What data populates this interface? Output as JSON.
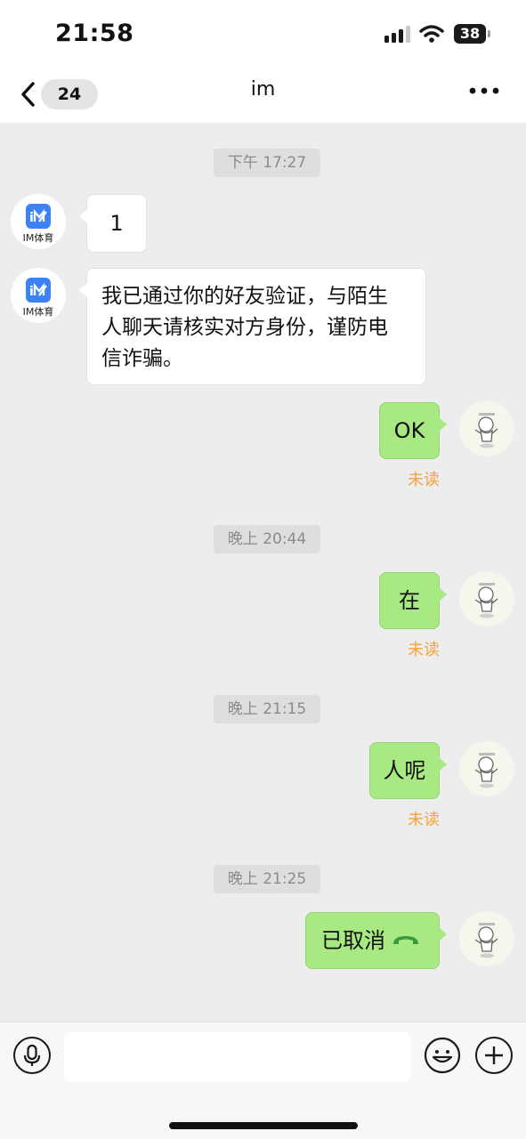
{
  "status_bar": {
    "time": "21:58",
    "battery": "38",
    "icons": [
      "signal-icon",
      "wifi-icon",
      "battery-icon"
    ]
  },
  "header": {
    "back_count": "24",
    "title": "im",
    "icons": [
      "chevron-left-icon",
      "more-icon"
    ]
  },
  "messages": [
    {
      "type": "time",
      "text": "下午 17:27"
    },
    {
      "type": "incoming",
      "sender_label": "IM体育",
      "text": "1"
    },
    {
      "type": "incoming",
      "sender_label": "IM体育",
      "lines": [
        "我已通过你的好友验证，与陌生",
        "人聊天请核实对方身份，谨防电",
        "信诈骗。"
      ]
    },
    {
      "type": "outgoing",
      "text": "OK",
      "status": "未读"
    },
    {
      "type": "time",
      "text": "晚上 20:44"
    },
    {
      "type": "outgoing",
      "text": "在",
      "status": "未读"
    },
    {
      "type": "time",
      "text": "晚上 21:15"
    },
    {
      "type": "outgoing",
      "text": "人呢",
      "status": "未读"
    },
    {
      "type": "time",
      "text": "晚上 21:25"
    },
    {
      "type": "outgoing-call",
      "text": "已取消",
      "icon": "hangup-phone-icon"
    }
  ],
  "input_bar": {
    "placeholder": "",
    "icons": [
      "microphone-icon",
      "emoji-icon",
      "plus-icon"
    ]
  },
  "colors": {
    "background": "#ededed",
    "outgoing_bubble": "#a9e983",
    "unread_status": "#f2a43a",
    "call_icon": "#3b9a3b",
    "im_logo": "#3d82f5"
  }
}
